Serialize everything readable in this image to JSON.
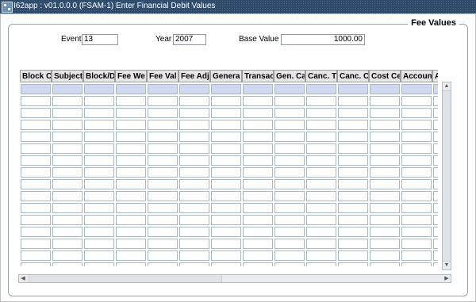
{
  "window": {
    "title": "I62app : v01.0.0.0 (FSAM-1) Enter Financial Debit Values",
    "icon": "app-icon"
  },
  "panel": {
    "title": "Fee Values"
  },
  "fields": {
    "event_label": "Event",
    "event_value": "13",
    "year_label": "Year",
    "year_value": "2007",
    "base_value_label": "Base Value",
    "base_value_value": "1000.00"
  },
  "table": {
    "columns": [
      "Block C",
      "Subject",
      "Block/D",
      "Fee We",
      "Fee Val",
      "Fee Adj",
      "Genera",
      "Transac",
      "Gen. Ca",
      "Canc. T",
      "Canc. C",
      "Cost Ce",
      "Account",
      "Ac"
    ],
    "row_count": 17,
    "selected_row": 0
  },
  "colors": {
    "titlebar": "#2d4a6a",
    "selected_row": "#d2d7f0",
    "cell_border": "#a9b8c7"
  }
}
